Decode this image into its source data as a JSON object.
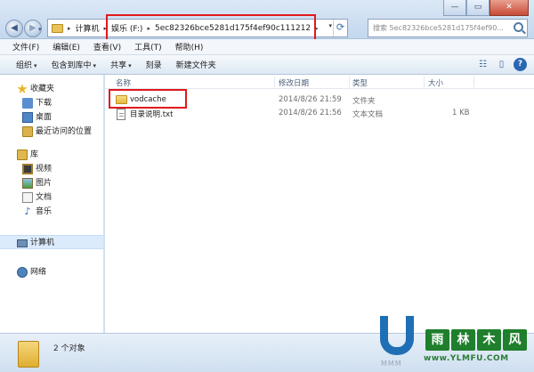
{
  "window": {
    "min_glyph": "—",
    "max_glyph": "▭",
    "close_glyph": "✕"
  },
  "nav": {
    "back_glyph": "◀",
    "forward_glyph": "▶",
    "history_glyph": "▾"
  },
  "address": {
    "crumbs": [
      "计算机",
      "娱乐 (F:)",
      "5ec82326bce5281d175f4ef90c111212"
    ],
    "separator": "▸",
    "dropdown_glyph": "▾",
    "refresh_glyph": "⟳"
  },
  "search": {
    "placeholder": "搜索 5ec82326bce5281d175f4ef90..."
  },
  "menu": [
    "文件(F)",
    "编辑(E)",
    "查看(V)",
    "工具(T)",
    "帮助(H)"
  ],
  "toolbar": {
    "organize": "组织",
    "include_in_library": "包含到库中",
    "share": "共享",
    "burn": "刻录",
    "new_folder": "新建文件夹",
    "caret": "▾",
    "view_glyph": "☷",
    "preview_glyph": "▯",
    "help_glyph": "?"
  },
  "sidebar": {
    "favorites": "收藏夹",
    "downloads": "下载",
    "desktop": "桌面",
    "recent": "最近访问的位置",
    "libraries": "库",
    "videos": "视频",
    "pictures": "图片",
    "documents": "文档",
    "music": "音乐",
    "music_glyph": "♪",
    "computer": "计算机",
    "network": "网络"
  },
  "columns": {
    "name": "名称",
    "modified": "修改日期",
    "type": "类型",
    "size": "大小"
  },
  "files": [
    {
      "name": "vodcache",
      "modified": "2014/8/26 21:59",
      "type": "文件夹",
      "size": ""
    },
    {
      "name": "目录说明.txt",
      "modified": "2014/8/26 21:56",
      "type": "文本文档",
      "size": "1 KB"
    }
  ],
  "status": {
    "count": "2 个对象"
  },
  "watermark": {
    "chars": [
      "雨",
      "林",
      "木",
      "风"
    ],
    "url": "www.YLMFU.COM",
    "mmm": "MMM"
  }
}
